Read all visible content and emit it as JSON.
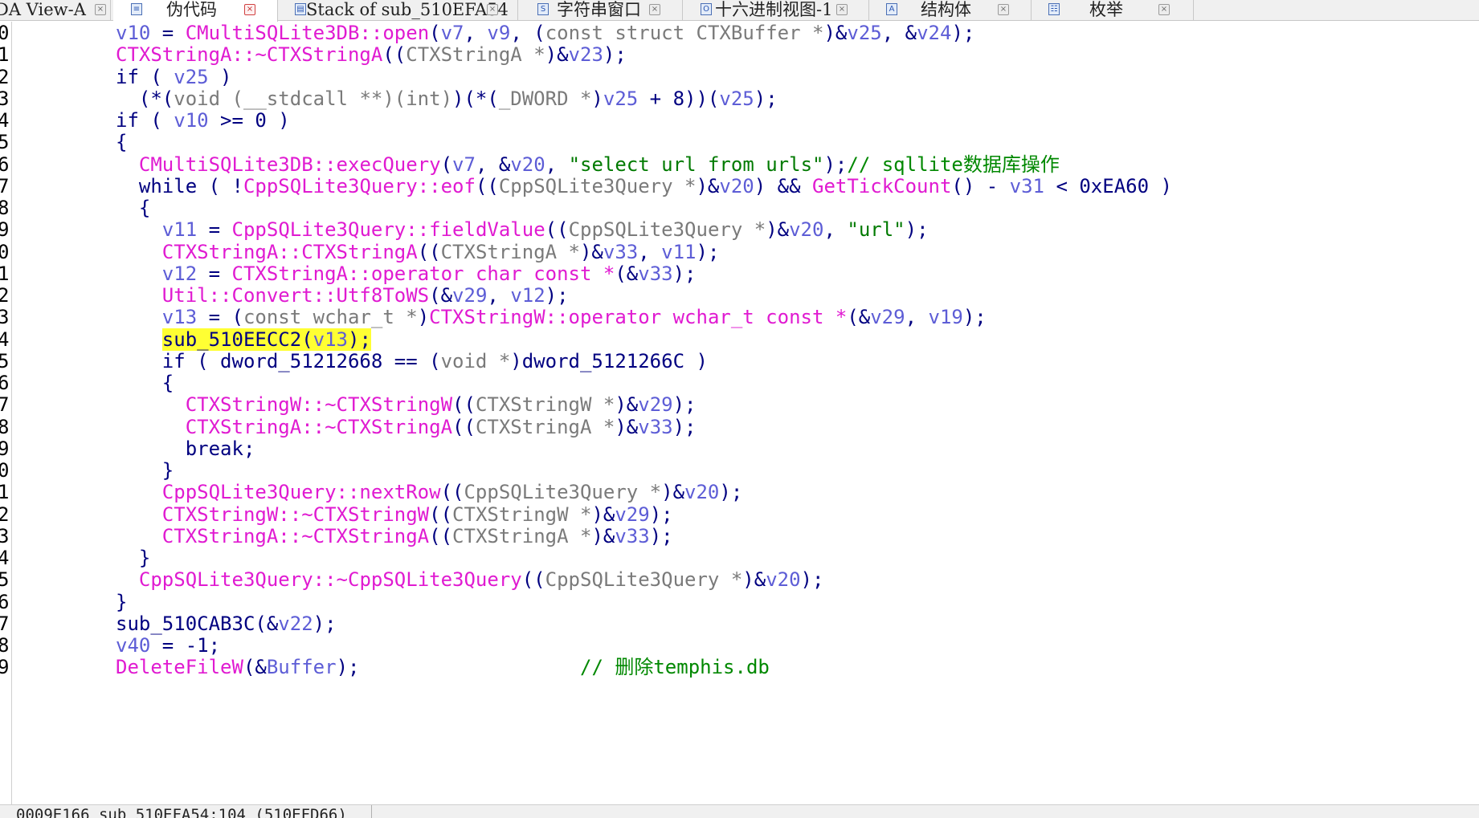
{
  "tabs": [
    {
      "label": "DA View-A",
      "icon": "",
      "active": false
    },
    {
      "label": "伪代码",
      "icon": "pseudocode",
      "active": true
    },
    {
      "label": "Stack of sub_510EFA54",
      "icon": "stack",
      "active": false
    },
    {
      "label": "字符串窗口",
      "icon": "strings",
      "active": false
    },
    {
      "label": "十六进制视图-1",
      "icon": "hex",
      "active": false
    },
    {
      "label": "结构体",
      "icon": "struct",
      "active": false
    },
    {
      "label": "枚举",
      "icon": "enum",
      "active": false
    }
  ],
  "tab_close_glyph": "×",
  "line_numbers": [
    "0",
    "1",
    "2",
    "3",
    "4",
    "5",
    "6",
    "7",
    "8",
    "9",
    "0",
    "1",
    "2",
    "3",
    "4",
    "5",
    "6",
    "7",
    "8",
    "9",
    "0",
    "1",
    "2",
    "3",
    "4",
    "5",
    "6",
    "7",
    "8",
    "9"
  ],
  "code_lines": [
    [
      [
        "v",
        "v10"
      ],
      [
        "k",
        " = "
      ],
      [
        "f",
        "CMultiSQLite3DB::open"
      ],
      [
        "k",
        "("
      ],
      [
        "v",
        "v7"
      ],
      [
        "k",
        ", "
      ],
      [
        "v",
        "v9"
      ],
      [
        "k",
        ", ("
      ],
      [
        "t",
        "const struct CTXBuffer *"
      ],
      [
        "k",
        ")&"
      ],
      [
        "v",
        "v25"
      ],
      [
        "k",
        ", &"
      ],
      [
        "v",
        "v24"
      ],
      [
        "k",
        ");"
      ]
    ],
    [
      [
        "f",
        "CTXStringA::~CTXStringA"
      ],
      [
        "k",
        "(("
      ],
      [
        "t",
        "CTXStringA *"
      ],
      [
        "k",
        ")&"
      ],
      [
        "v",
        "v23"
      ],
      [
        "k",
        ");"
      ]
    ],
    [
      [
        "k",
        "if ( "
      ],
      [
        "v",
        "v25"
      ],
      [
        "k",
        " )"
      ]
    ],
    [
      [
        "k",
        "  (*("
      ],
      [
        "t",
        "void (__stdcall **)(int)"
      ],
      [
        "k",
        ")(*("
      ],
      [
        "t",
        "_DWORD *"
      ],
      [
        "k",
        ")"
      ],
      [
        "v",
        "v25"
      ],
      [
        "k",
        " + 8))("
      ],
      [
        "v",
        "v25"
      ],
      [
        "k",
        ");"
      ]
    ],
    [
      [
        "k",
        "if ( "
      ],
      [
        "v",
        "v10"
      ],
      [
        "k",
        " >= 0 )"
      ]
    ],
    [
      [
        "k",
        "{"
      ]
    ],
    [
      [
        "k",
        "  "
      ],
      [
        "f",
        "CMultiSQLite3DB::execQuery"
      ],
      [
        "k",
        "("
      ],
      [
        "v",
        "v7"
      ],
      [
        "k",
        ", &"
      ],
      [
        "v",
        "v20"
      ],
      [
        "k",
        ", "
      ],
      [
        "s",
        "\"select url from urls\""
      ],
      [
        "k",
        ");"
      ],
      [
        "c",
        "// sqllite数据库操作"
      ]
    ],
    [
      [
        "k",
        "  while ( !"
      ],
      [
        "f",
        "CppSQLite3Query::eof"
      ],
      [
        "k",
        "(("
      ],
      [
        "t",
        "CppSQLite3Query *"
      ],
      [
        "k",
        ")&"
      ],
      [
        "v",
        "v20"
      ],
      [
        "k",
        ") && "
      ],
      [
        "f",
        "GetTickCount"
      ],
      [
        "k",
        "() - "
      ],
      [
        "v",
        "v31"
      ],
      [
        "k",
        " < 0xEA60 )"
      ]
    ],
    [
      [
        "k",
        "  {"
      ]
    ],
    [
      [
        "k",
        "    "
      ],
      [
        "v",
        "v11"
      ],
      [
        "k",
        " = "
      ],
      [
        "f",
        "CppSQLite3Query::fieldValue"
      ],
      [
        "k",
        "(("
      ],
      [
        "t",
        "CppSQLite3Query *"
      ],
      [
        "k",
        ")&"
      ],
      [
        "v",
        "v20"
      ],
      [
        "k",
        ", "
      ],
      [
        "s",
        "\"url\""
      ],
      [
        "k",
        ");"
      ]
    ],
    [
      [
        "k",
        "    "
      ],
      [
        "f",
        "CTXStringA::CTXStringA"
      ],
      [
        "k",
        "(("
      ],
      [
        "t",
        "CTXStringA *"
      ],
      [
        "k",
        ")&"
      ],
      [
        "v",
        "v33"
      ],
      [
        "k",
        ", "
      ],
      [
        "v",
        "v11"
      ],
      [
        "k",
        ");"
      ]
    ],
    [
      [
        "k",
        "    "
      ],
      [
        "v",
        "v12"
      ],
      [
        "k",
        " = "
      ],
      [
        "f",
        "CTXStringA::operator char const *"
      ],
      [
        "k",
        "(&"
      ],
      [
        "v",
        "v33"
      ],
      [
        "k",
        ");"
      ]
    ],
    [
      [
        "k",
        "    "
      ],
      [
        "f",
        "Util::Convert::Utf8ToWS"
      ],
      [
        "k",
        "(&"
      ],
      [
        "v",
        "v29"
      ],
      [
        "k",
        ", "
      ],
      [
        "v",
        "v12"
      ],
      [
        "k",
        ");"
      ]
    ],
    [
      [
        "k",
        "    "
      ],
      [
        "v",
        "v13"
      ],
      [
        "k",
        " = ("
      ],
      [
        "t",
        "const wchar_t *"
      ],
      [
        "k",
        ")"
      ],
      [
        "f",
        "CTXStringW::operator wchar_t const *"
      ],
      [
        "k",
        "(&"
      ],
      [
        "v",
        "v29"
      ],
      [
        "k",
        ", "
      ],
      [
        "v",
        "v19"
      ],
      [
        "k",
        ");"
      ]
    ],
    [
      [
        "k",
        "    "
      ],
      [
        "h",
        "sub_510EECC2("
      ],
      [
        "hv",
        "v13"
      ],
      [
        "h",
        ");"
      ]
    ],
    [
      [
        "k",
        "    if ( dword_51212668 == ("
      ],
      [
        "t",
        "void *"
      ],
      [
        "k",
        ")dword_5121266C )"
      ]
    ],
    [
      [
        "k",
        "    {"
      ]
    ],
    [
      [
        "k",
        "      "
      ],
      [
        "f",
        "CTXStringW::~CTXStringW"
      ],
      [
        "k",
        "(("
      ],
      [
        "t",
        "CTXStringW *"
      ],
      [
        "k",
        ")&"
      ],
      [
        "v",
        "v29"
      ],
      [
        "k",
        ");"
      ]
    ],
    [
      [
        "k",
        "      "
      ],
      [
        "f",
        "CTXStringA::~CTXStringA"
      ],
      [
        "k",
        "(("
      ],
      [
        "t",
        "CTXStringA *"
      ],
      [
        "k",
        ")&"
      ],
      [
        "v",
        "v33"
      ],
      [
        "k",
        ");"
      ]
    ],
    [
      [
        "k",
        "      break;"
      ]
    ],
    [
      [
        "k",
        "    }"
      ]
    ],
    [
      [
        "k",
        "    "
      ],
      [
        "f",
        "CppSQLite3Query::nextRow"
      ],
      [
        "k",
        "(("
      ],
      [
        "t",
        "CppSQLite3Query *"
      ],
      [
        "k",
        ")&"
      ],
      [
        "v",
        "v20"
      ],
      [
        "k",
        ");"
      ]
    ],
    [
      [
        "k",
        "    "
      ],
      [
        "f",
        "CTXStringW::~CTXStringW"
      ],
      [
        "k",
        "(("
      ],
      [
        "t",
        "CTXStringW *"
      ],
      [
        "k",
        ")&"
      ],
      [
        "v",
        "v29"
      ],
      [
        "k",
        ");"
      ]
    ],
    [
      [
        "k",
        "    "
      ],
      [
        "f",
        "CTXStringA::~CTXStringA"
      ],
      [
        "k",
        "(("
      ],
      [
        "t",
        "CTXStringA *"
      ],
      [
        "k",
        ")&"
      ],
      [
        "v",
        "v33"
      ],
      [
        "k",
        ");"
      ]
    ],
    [
      [
        "k",
        "  }"
      ]
    ],
    [
      [
        "k",
        "  "
      ],
      [
        "f",
        "CppSQLite3Query::~CppSQLite3Query"
      ],
      [
        "k",
        "(("
      ],
      [
        "t",
        "CppSQLite3Query *"
      ],
      [
        "k",
        ")&"
      ],
      [
        "v",
        "v20"
      ],
      [
        "k",
        ");"
      ]
    ],
    [
      [
        "k",
        "}"
      ]
    ],
    [
      [
        "k",
        "sub_510CAB3C(&"
      ],
      [
        "v",
        "v22"
      ],
      [
        "k",
        ");"
      ]
    ],
    [
      [
        "v",
        "v40"
      ],
      [
        "k",
        " = -1;"
      ]
    ],
    [
      [
        "f",
        "DeleteFileW"
      ],
      [
        "k",
        "(&"
      ],
      [
        "v",
        "Buffer"
      ],
      [
        "k",
        ");                   "
      ],
      [
        "c",
        "// 删除temphis.db"
      ]
    ]
  ],
  "status": {
    "text": "0009E166 sub_510EFA54:104 (510EFD66)"
  },
  "colors": {
    "keyword": "#000080",
    "function": "#e01ad1",
    "variable": "#5d5dd6",
    "type": "#7a7a7a",
    "string": "#007a00",
    "comment": "#008800",
    "highlight": "#ffff33"
  }
}
